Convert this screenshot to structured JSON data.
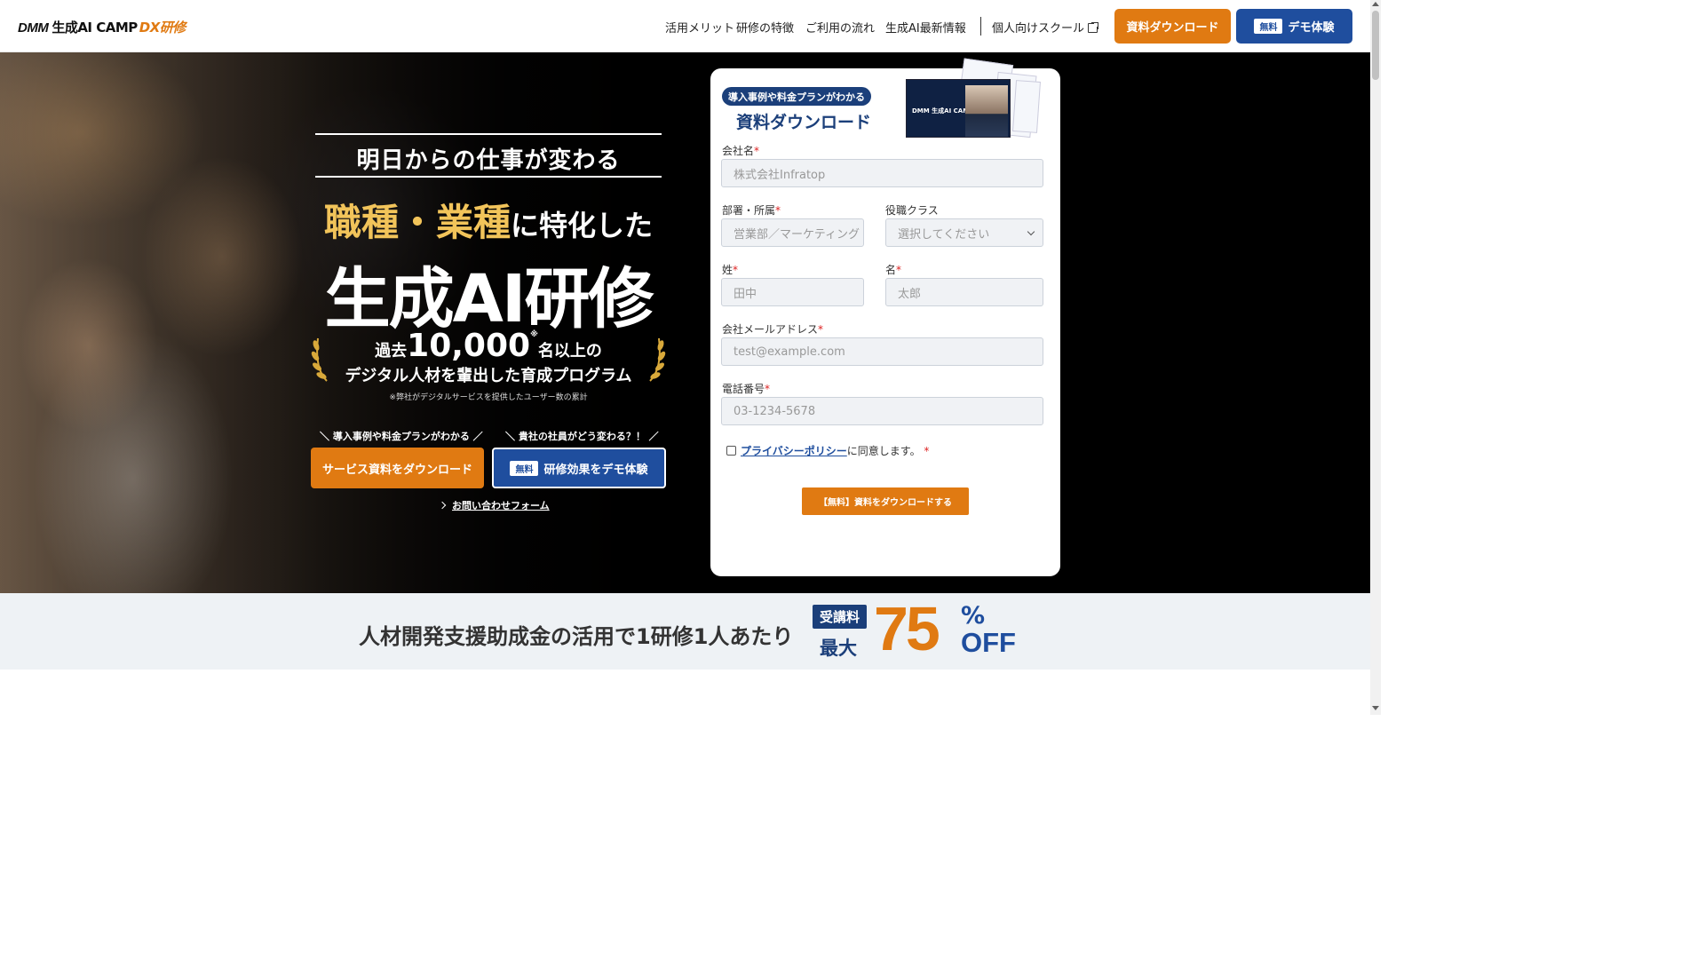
{
  "header": {
    "logo": {
      "dmm": "DMM",
      "camp": "生成AI CAMP",
      "dx": "DX研修"
    },
    "nav": [
      {
        "label": "活用メリット"
      },
      {
        "label": "研修の特徴"
      },
      {
        "label": "ご利用の流れ"
      },
      {
        "label": "生成AI最新情報"
      },
      {
        "label": "個人向けスクール"
      }
    ],
    "download_button": "資料ダウンロード",
    "demo_button": {
      "tag": "無料",
      "label": "デモ体験"
    }
  },
  "hero": {
    "sub_headline": "明日からの仕事が変わる",
    "headline_gold": "職種・業種",
    "headline_rest": "に特化した",
    "headline_main": "生成AI研修",
    "stat": {
      "prefix": "過去",
      "number": "10,000",
      "mark": "※",
      "suffix": "名以上の"
    },
    "stat_sub": "デジタル人材を輩出した育成プログラム",
    "stat_note": "※弊社がデジタルサービスを提供したユーザー数の累計",
    "cta_left_caption": "＼ 導入事例や料金プランがわかる ／",
    "cta_right_caption": "＼ 貴社の社員がどう変わる？！ ／",
    "cta_left_button": "サービス資料をダウンロード",
    "cta_right_button": {
      "tag": "無料",
      "label": "研修効果をデモ体験"
    },
    "contact_link": "お問い合わせフォーム"
  },
  "form": {
    "pill": "導入事例や料金プランがわかる",
    "title": "資料ダウンロード",
    "brochure_label": "DMM 生成AI CAMP DX研修",
    "fields": {
      "company": {
        "label": "会社名",
        "required": "*",
        "placeholder": "株式会社Infratop"
      },
      "department": {
        "label": "部署・所属",
        "required": "*",
        "placeholder": "営業部／マーケティング"
      },
      "position": {
        "label": "役職クラス",
        "placeholder": "選択してください"
      },
      "last_name": {
        "label": "姓",
        "required": "*",
        "placeholder": "田中"
      },
      "first_name": {
        "label": "名",
        "required": "*",
        "placeholder": "太郎"
      },
      "email": {
        "label": "会社メールアドレス",
        "required": "*",
        "placeholder": "test@example.com"
      },
      "phone": {
        "label": "電話番号",
        "required": "*",
        "placeholder": "03-1234-5678"
      }
    },
    "consent": {
      "link": "プライバシーポリシー",
      "text": "に同意します。",
      "required": "*"
    },
    "submit": "【無料】資料をダウンロードする"
  },
  "banner": {
    "text": "人材開発支援助成金の活用で1研修1人あたり",
    "badge": "受講料",
    "max": "最大",
    "number": "75",
    "percent": "%",
    "off": "OFF"
  },
  "colors": {
    "accent_orange": "#e07a12",
    "brand_blue": "#1f4e9e",
    "navy": "#1b3f7a",
    "gold": "#f2c45a"
  }
}
